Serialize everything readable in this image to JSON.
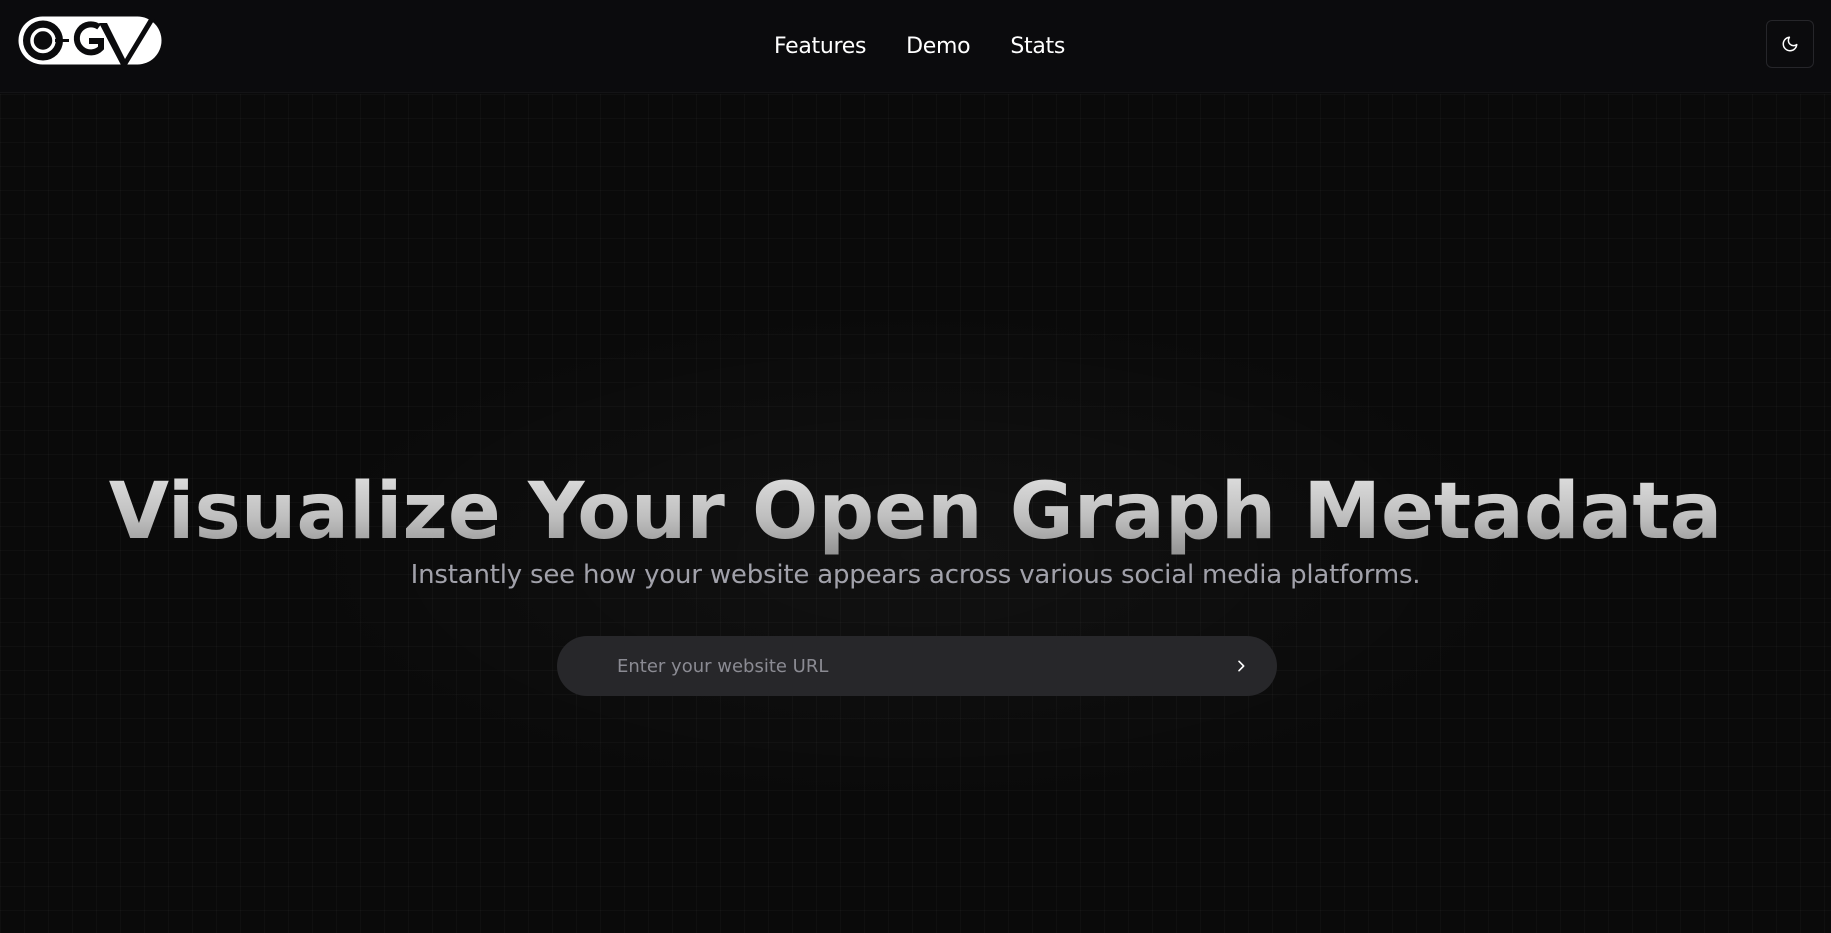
{
  "header": {
    "logo_text": "OGV",
    "nav": [
      {
        "label": "Features"
      },
      {
        "label": "Demo"
      },
      {
        "label": "Stats"
      }
    ],
    "theme_toggle_icon": "moon-icon"
  },
  "hero": {
    "title": "Visualize Your Open Graph Metadata",
    "subtitle": "Instantly see how your website appears across various social media platforms.",
    "url_input": {
      "placeholder": "Enter your website URL",
      "value": ""
    },
    "submit_icon": "chevron-right-icon"
  },
  "colors": {
    "background": "#0a0a0b",
    "input_background": "#27272a",
    "subtitle": "#a1a1aa",
    "nav_text": "#ffffff"
  }
}
